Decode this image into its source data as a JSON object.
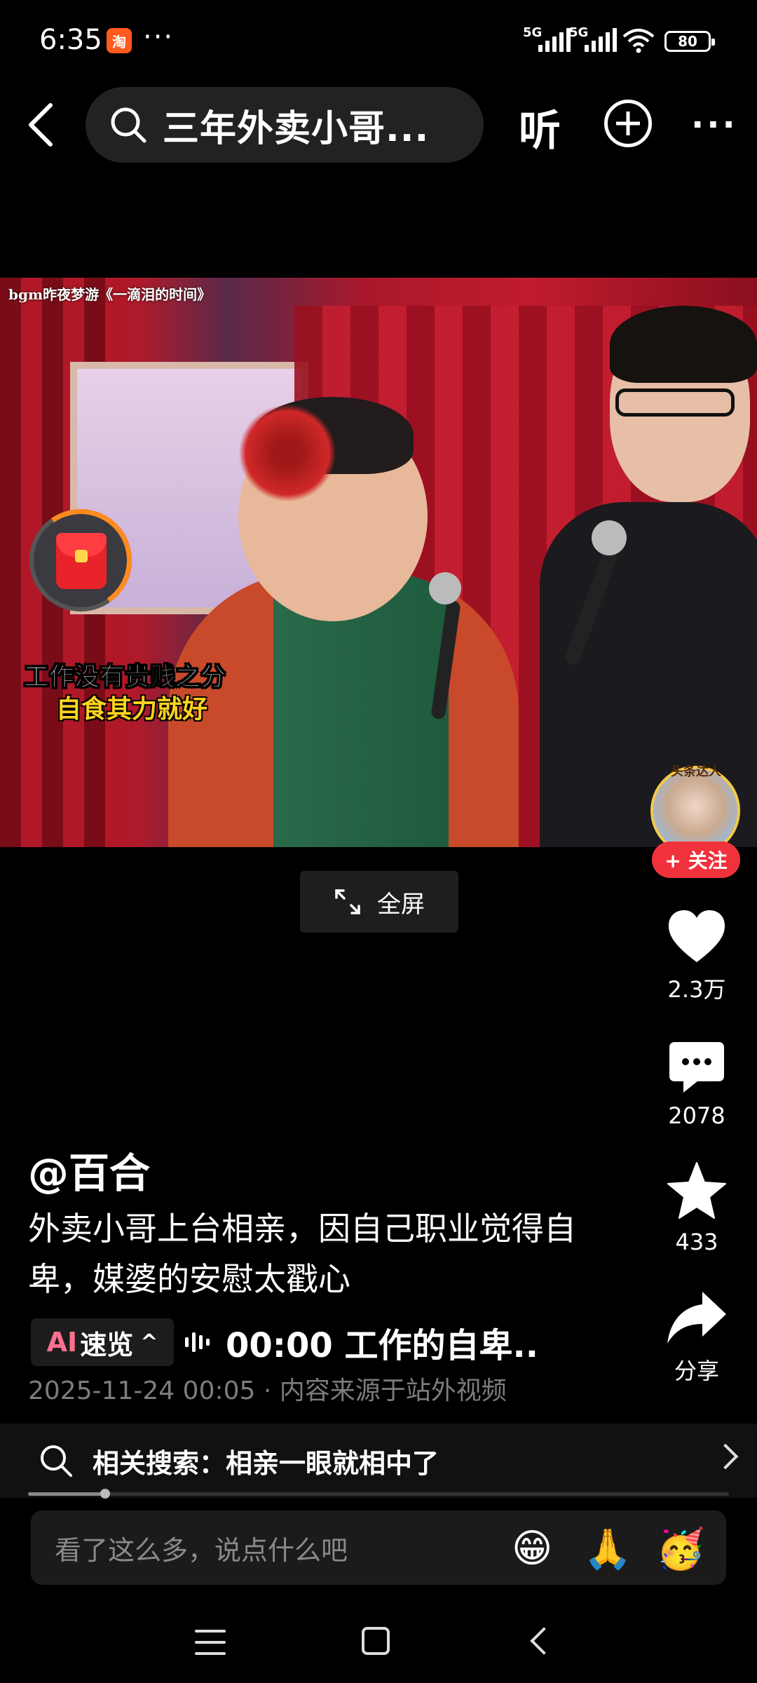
{
  "status_bar": {
    "time": "6:35",
    "app_badge": "淘",
    "dots": "···",
    "network_1": "5G",
    "network_2": "5G",
    "battery": "80"
  },
  "nav": {
    "search_text": "三年外卖小哥...",
    "listen_label": "听"
  },
  "video": {
    "bgm": "bgm昨夜梦游《一滴泪的时间》",
    "caption_line1": "工作没有贵贱之分",
    "caption_line2": "自食其力就好",
    "avatar_tag": "头条达人",
    "follow_label": "+ 关注",
    "fullscreen_label": "全屏"
  },
  "actions": {
    "like_count": "2.3万",
    "comment_count": "2078",
    "favorite_count": "433",
    "share_label": "分享"
  },
  "post": {
    "author": "@百合",
    "title": "外卖小哥上台相亲，因自己职业觉得自卑，媒婆的安慰太戳心",
    "ai_mark": "AI",
    "ai_label": "速览",
    "ai_chevron": "^",
    "ai_summary": "00:00 工作的自卑..",
    "meta": "2025-11-24 00:05 · 内容来源于站外视频"
  },
  "related": {
    "text": "相关搜索：相亲一眼就相中了"
  },
  "playback": {
    "progress_fraction": 0.11
  },
  "comment": {
    "placeholder": "看了这么多，说点什么吧",
    "emojis": [
      "😁",
      "🙏",
      "🥳"
    ]
  },
  "colors": {
    "follow_red": "#f0323c",
    "ai_pink": "#ff6f8e",
    "caption_yellow": "#ffd21f"
  }
}
